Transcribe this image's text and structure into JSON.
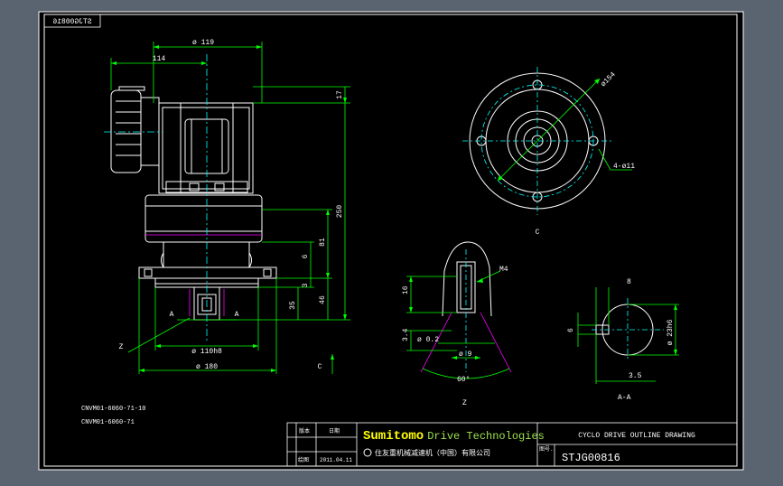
{
  "viewport": {
    "background": "#5a6470",
    "sheet_color": "#000000",
    "frame_color": "#ffffff"
  },
  "colors": {
    "outline": "#ffffff",
    "dimension": "#00ff00",
    "centerline": "#00ffff",
    "hidden": "#ff00ff",
    "label": "#ffffff"
  },
  "corner_tag": "STJG00816",
  "dimensions": {
    "dia_top": "ø 119",
    "offset_114": "114",
    "h_17": "17",
    "h_250": "250",
    "h_81": "81",
    "h_6": "6",
    "h_3": "3",
    "h_35": "35",
    "h_46": "46",
    "dia_110": "ø 110h8",
    "dia_180": "ø 180",
    "section_a_left": "A",
    "section_a_right": "A",
    "detail_z": "Z",
    "c_mark": "C"
  },
  "flange_view": {
    "pcd": "ø154",
    "holes": "4-ø11",
    "view_label": "C"
  },
  "detail_view": {
    "thread": "M4",
    "depth": "16",
    "dim_34": "3.4",
    "dia_02": "ø 0.2",
    "dia_9": "ø 9",
    "angle": "60°",
    "label": "Z"
  },
  "section_view": {
    "key_width": "8",
    "key_height": "6",
    "shaft_dia": "ø 23h6",
    "offset": "3.5",
    "label": "A-A"
  },
  "model_codes": [
    "CNVM01-6060-71-10",
    "CNVM01-6060-71"
  ],
  "title_block": {
    "brand_primary": "Sumitomo",
    "brand_secondary": "Drive Technologies",
    "company_line": "住友重机械减速机（中国）有限公司",
    "label_version": "版本",
    "label_date": "日期",
    "label_drawing": "绘图",
    "date_value": "2011.04.11",
    "drawing_title": "CYCLO DRIVE OUTLINE DRAWING",
    "label_no": "图号.",
    "drawing_no": "STJG00816"
  }
}
